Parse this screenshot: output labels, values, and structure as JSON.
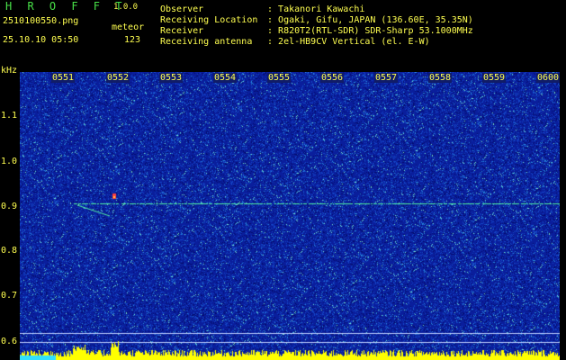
{
  "app": {
    "title": "H R O F F T",
    "version": "1.0.0"
  },
  "file": {
    "name": "2510100550.png",
    "timestamp": "25.10.10 05:50"
  },
  "meteor": {
    "label": "meteor",
    "count": "123"
  },
  "info": [
    {
      "label": "Observer",
      "value": "Takanori Kawachi"
    },
    {
      "label": "Receiving Location",
      "value": "Ogaki, Gifu, JAPAN (136.60E, 35.35N)"
    },
    {
      "label": "Receiver",
      "value": "R820T2(RTL-SDR) SDR-Sharp 53.1000MHz"
    },
    {
      "label": "Receiving antenna",
      "value": "2el-HB9CV Vertical (el. E-W)"
    }
  ],
  "yaxis": {
    "unit": "kHz",
    "ticks": [
      "1.1",
      "1.0",
      "0.9",
      "0.8",
      "0.7",
      "0.6"
    ]
  },
  "xaxis": {
    "ticks": [
      "0551",
      "0552",
      "0553",
      "0554",
      "0555",
      "0556",
      "0557",
      "0558",
      "0559",
      "0600"
    ]
  },
  "colors": {
    "background": "#000000",
    "spectrogram_base": "#0a1e9c",
    "signal_line": "#4ff0a0",
    "label_yellow": "#ffff50",
    "title_green": "#48e048",
    "power_bar": "#ffff00",
    "meteor_echo": "#ff4040"
  }
}
